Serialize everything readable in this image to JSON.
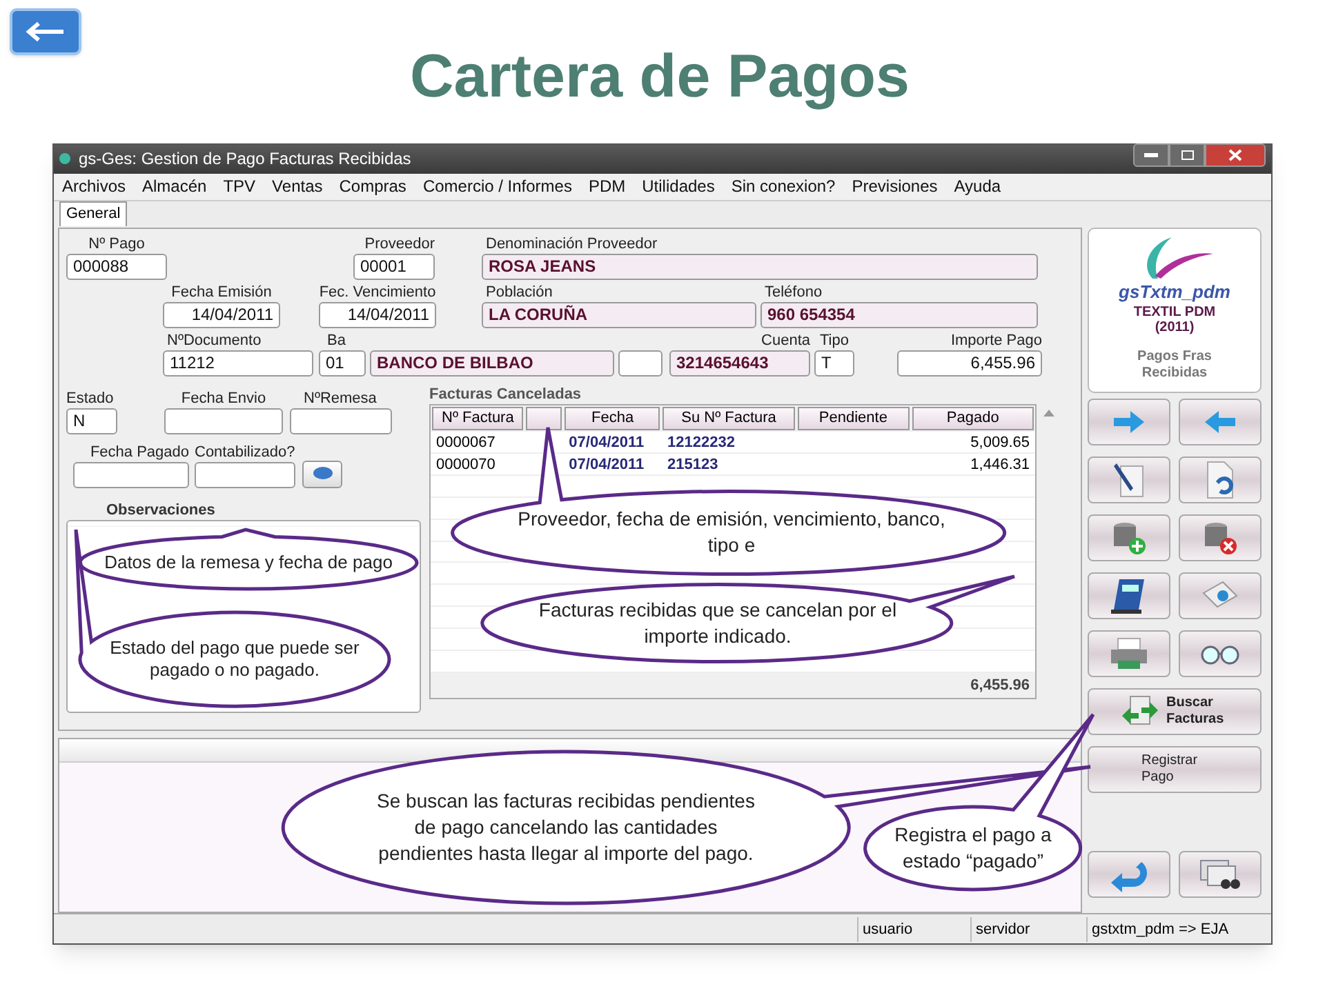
{
  "slide": {
    "title": "Cartera de Pagos"
  },
  "window": {
    "title": "gs-Ges: Gestion de Pago Facturas Recibidas"
  },
  "menu": [
    "Archivos",
    "Almacén",
    "TPV",
    "Ventas",
    "Compras",
    "Comercio / Informes",
    "PDM",
    "Utilidades",
    "Sin conexion?",
    "Previsiones",
    "Ayuda"
  ],
  "tabs": [
    {
      "label": "General",
      "selected": true
    }
  ],
  "form": {
    "rows": [
      [
        {
          "label": "Nº Pago",
          "value": "000088"
        },
        {
          "label": "Proveedor",
          "value": "00001"
        },
        {
          "label": "Denominación Proveedor",
          "value": "ROSA JEANS"
        }
      ],
      [
        {
          "label": "Fecha Emisión",
          "value": "14/04/2011"
        },
        {
          "label": "Fec. Vencimiento",
          "value": "14/04/2011"
        },
        {
          "label": "Población",
          "value": "LA CORUÑA"
        },
        {
          "label": "Teléfono",
          "value": "960 654354"
        }
      ],
      [
        {
          "label": "NºDocumento",
          "value": "11212"
        },
        {
          "label": "Ba",
          "value": "01"
        },
        {
          "value": "BANCO DE BILBAO"
        },
        {},
        {
          "label": "Cuenta",
          "value": "3214654643"
        },
        {
          "label": "Tipo",
          "value": "T"
        },
        {
          "label": "Importe Pago",
          "value": "6,455.96"
        }
      ],
      [
        {
          "label": "Estado",
          "value": "N"
        },
        {
          "label": "Fecha Envio"
        },
        {
          "label": "NºRemesa"
        }
      ],
      [
        {
          "label": "Fecha Pagado"
        },
        {
          "label": "Contabilizado?"
        }
      ]
    ],
    "notes_label": "Observaciones"
  },
  "invoices": {
    "title": "Facturas Canceladas",
    "columns": [
      "Nº Factura",
      "",
      "Fecha",
      "Su Nº Factura",
      "Pendiente",
      "Pagado"
    ],
    "rows": [
      [
        "0000067",
        "",
        "07/04/2011",
        "12122232",
        "",
        "5,009.65"
      ],
      [
        "0000070",
        "",
        "07/04/2011",
        "215123",
        "",
        "1,446.31"
      ]
    ],
    "total": "6,455.96"
  },
  "logo": {
    "name": "gsTxtm_pdm",
    "line1": "TEXTIL PDM",
    "line2": "(2011)",
    "caption": "Pagos Fras Recibidas"
  },
  "side_buttons": [
    "Buscar Facturas",
    "Registrar Pago"
  ],
  "status_bar": [
    "usuario",
    "servidor",
    "gstxtm_pdm => EJA"
  ],
  "callouts": [
    "Datos de la remesa y fecha de pago",
    "Estado del pago que puede ser pagado o no pagado.",
    "Proveedor, fecha de emisión, vencimiento, banco, tipo e",
    "Facturas recibidas que se cancelan por el importe indicado.",
    "Se buscan las facturas recibidas pendientes de pago cancelando las cantidades pendientes hasta llegar al importe del pago.",
    "Registra el pago a estado “pagado”"
  ]
}
